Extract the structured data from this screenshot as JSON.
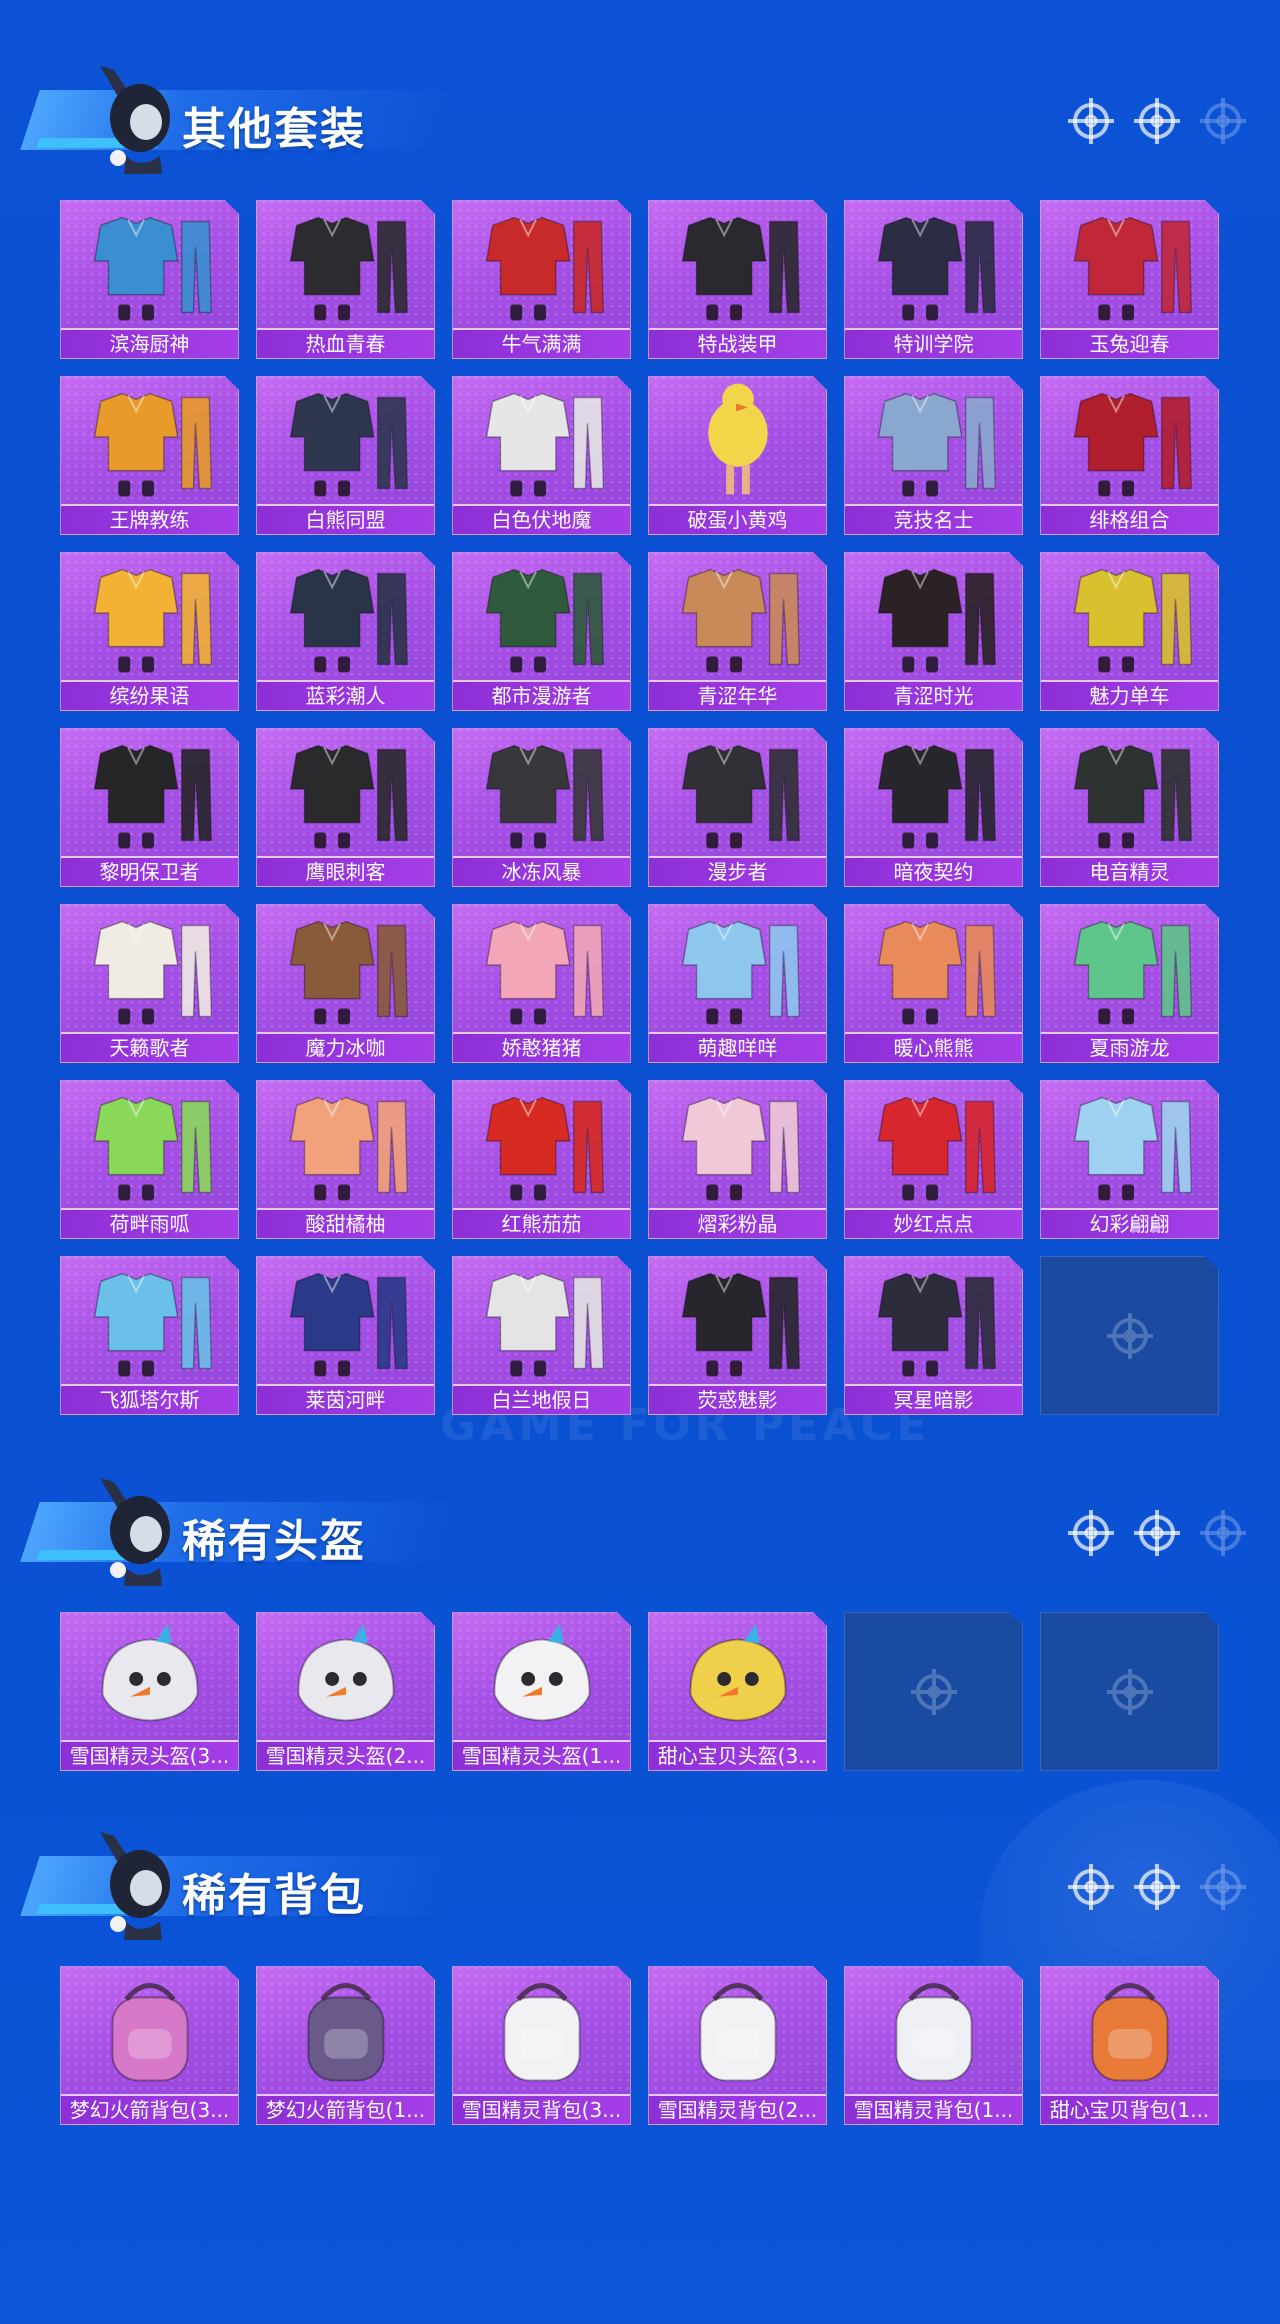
{
  "sections": [
    {
      "title": "其他套装",
      "items": [
        {
          "name": "滨海厨神",
          "art": "outfit",
          "tone": "#3a8fd0"
        },
        {
          "name": "热血青春",
          "art": "outfit",
          "tone": "#2c2c30"
        },
        {
          "name": "牛气满满",
          "art": "outfit",
          "tone": "#c82a2a"
        },
        {
          "name": "特战装甲",
          "art": "outfit",
          "tone": "#2a2a2e"
        },
        {
          "name": "特训学院",
          "art": "outfit",
          "tone": "#2a2d44"
        },
        {
          "name": "玉兔迎春",
          "art": "outfit",
          "tone": "#c0283a"
        },
        {
          "name": "王牌教练",
          "art": "outfit",
          "tone": "#e89a2a"
        },
        {
          "name": "白熊同盟",
          "art": "outfit",
          "tone": "#2e3650"
        },
        {
          "name": "白色伏地魔",
          "art": "outfit",
          "tone": "#e6e6e6"
        },
        {
          "name": "破蛋小黄鸡",
          "art": "chick",
          "tone": "#f1d64a"
        },
        {
          "name": "竞技名士",
          "art": "outfit",
          "tone": "#8aa8cf"
        },
        {
          "name": "绯格组合",
          "art": "outfit",
          "tone": "#b11f2f"
        },
        {
          "name": "缤纷果语",
          "art": "outfit",
          "tone": "#f2b233"
        },
        {
          "name": "蓝彩潮人",
          "art": "outfit",
          "tone": "#2a3448"
        },
        {
          "name": "都市漫游者",
          "art": "outfit",
          "tone": "#2f5a3c"
        },
        {
          "name": "青涩年华",
          "art": "outfit",
          "tone": "#c98a5a"
        },
        {
          "name": "青涩时光",
          "art": "outfit",
          "tone": "#2a2224"
        },
        {
          "name": "魅力单车",
          "art": "outfit",
          "tone": "#d9c02e"
        },
        {
          "name": "黎明保卫者",
          "art": "outfit",
          "tone": "#262628"
        },
        {
          "name": "鹰眼刺客",
          "art": "outfit",
          "tone": "#2a2a2d"
        },
        {
          "name": "冰冻风暴",
          "art": "outfit",
          "tone": "#38383c"
        },
        {
          "name": "漫步者",
          "art": "outfit",
          "tone": "#303036"
        },
        {
          "name": "暗夜契约",
          "art": "outfit",
          "tone": "#26262c"
        },
        {
          "name": "电音精灵",
          "art": "outfit",
          "tone": "#2d3330"
        },
        {
          "name": "天籁歌者",
          "art": "outfit",
          "tone": "#f0ece4"
        },
        {
          "name": "魔力冰咖",
          "art": "outfit",
          "tone": "#8a5a3a"
        },
        {
          "name": "娇憨猪猪",
          "art": "outfit",
          "tone": "#f2a6b8"
        },
        {
          "name": "萌趣咩咩",
          "art": "outfit",
          "tone": "#8ec6ee"
        },
        {
          "name": "暖心熊熊",
          "art": "outfit",
          "tone": "#e88a5a"
        },
        {
          "name": "夏雨游龙",
          "art": "outfit",
          "tone": "#5ec68a"
        },
        {
          "name": "荷畔雨呱",
          "art": "outfit",
          "tone": "#8ad85a"
        },
        {
          "name": "酸甜橘柚",
          "art": "outfit",
          "tone": "#f2a27a"
        },
        {
          "name": "红熊茄茄",
          "art": "outfit",
          "tone": "#d62a22"
        },
        {
          "name": "熠彩粉晶",
          "art": "outfit",
          "tone": "#f0c8d8"
        },
        {
          "name": "妙红点点",
          "art": "outfit",
          "tone": "#d8262e"
        },
        {
          "name": "幻彩翩翩",
          "art": "outfit",
          "tone": "#9ed2f0"
        },
        {
          "name": "飞狐塔尔斯",
          "art": "outfit",
          "tone": "#6ac0e8"
        },
        {
          "name": "莱茵河畔",
          "art": "outfit",
          "tone": "#2a3a88"
        },
        {
          "name": "白兰地假日",
          "art": "outfit",
          "tone": "#e4e4e4"
        },
        {
          "name": "荧惑魅影",
          "art": "outfit",
          "tone": "#26262c"
        },
        {
          "name": "冥星暗影",
          "art": "outfit",
          "tone": "#2c2c3c"
        },
        {
          "name": "",
          "art": "empty",
          "tone": ""
        }
      ]
    },
    {
      "title": "稀有头盔",
      "items": [
        {
          "name": "雪国精灵头盔(3...",
          "art": "helmet",
          "tone": "#e8e8ee"
        },
        {
          "name": "雪国精灵头盔(2...",
          "art": "helmet",
          "tone": "#e8e8ee"
        },
        {
          "name": "雪国精灵头盔(1...",
          "art": "helmet",
          "tone": "#f2f2f4"
        },
        {
          "name": "甜心宝贝头盔(3...",
          "art": "helmet",
          "tone": "#f0d04a"
        },
        {
          "name": "",
          "art": "empty",
          "tone": ""
        },
        {
          "name": "",
          "art": "empty",
          "tone": ""
        }
      ]
    },
    {
      "title": "稀有背包",
      "items": [
        {
          "name": "梦幻火箭背包(3...",
          "art": "backpack",
          "tone": "#d878c8"
        },
        {
          "name": "梦幻火箭背包(1...",
          "art": "backpack",
          "tone": "#6a5a8a"
        },
        {
          "name": "雪国精灵背包(3...",
          "art": "backpack",
          "tone": "#f2f2f4"
        },
        {
          "name": "雪国精灵背包(2...",
          "art": "backpack",
          "tone": "#f2f2f4"
        },
        {
          "name": "雪国精灵背包(1...",
          "art": "backpack",
          "tone": "#eef0f4"
        },
        {
          "name": "甜心宝贝背包(1...",
          "art": "backpack",
          "tone": "#e87a3a"
        }
      ]
    }
  ],
  "watermark": "GAME FOR PEACE",
  "icons": {
    "header_mascot": "mascot-icon",
    "target": "crosshair-icon"
  }
}
